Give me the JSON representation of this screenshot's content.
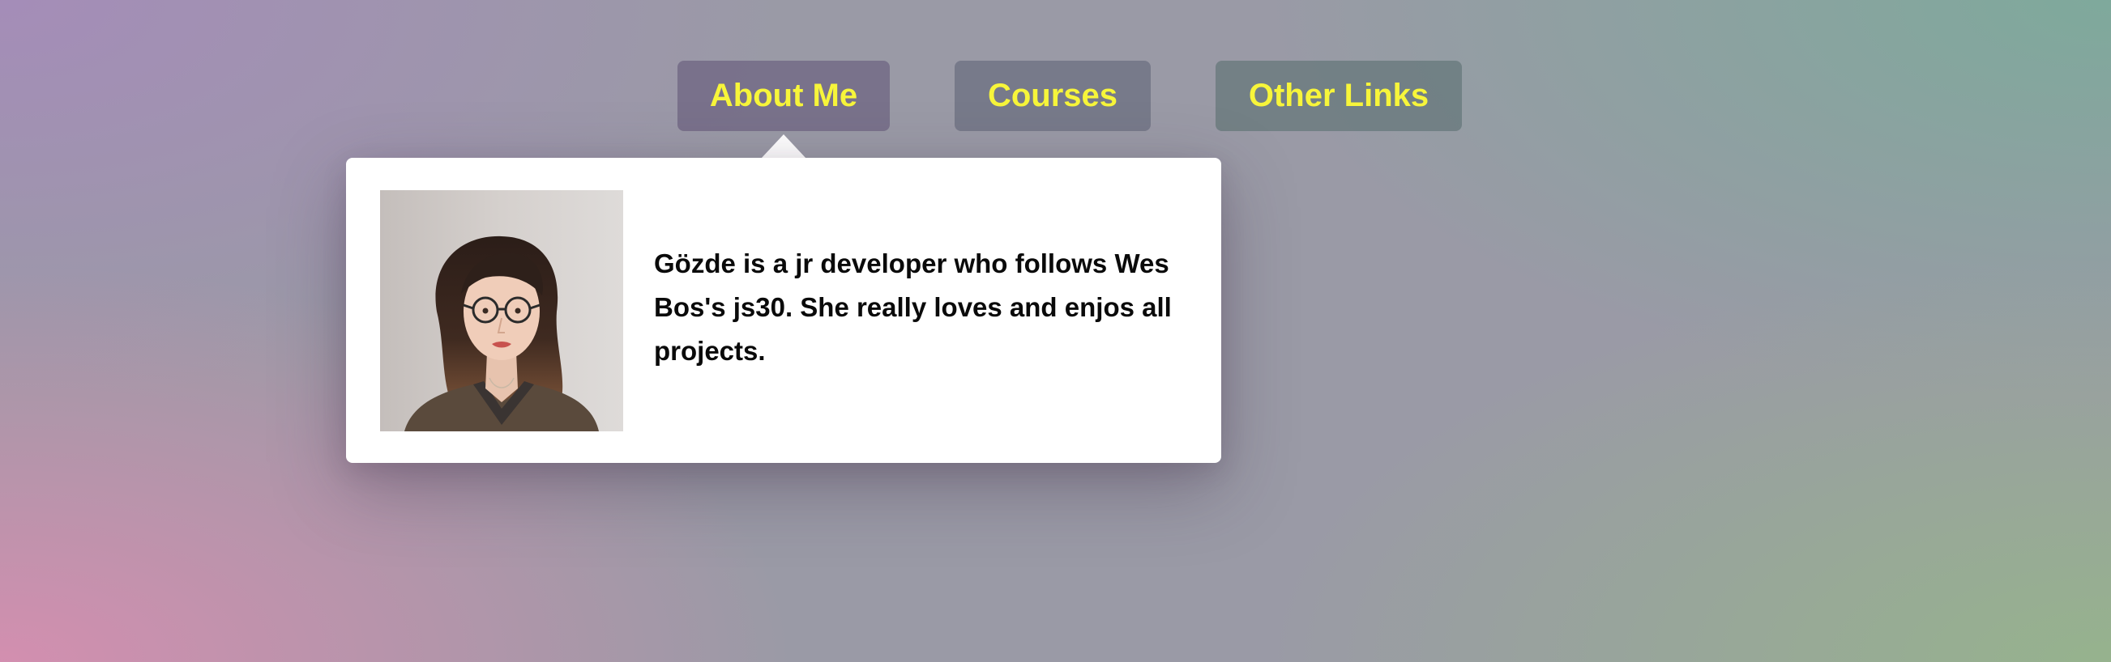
{
  "nav": {
    "items": [
      {
        "label": "About Me"
      },
      {
        "label": "Courses"
      },
      {
        "label": "Other Links"
      }
    ],
    "text_color": "#f7f53a"
  },
  "dropdown": {
    "bio": "Gözde is a jr developer who follows Wes Bos's js30. She really loves and enjos all projects."
  }
}
